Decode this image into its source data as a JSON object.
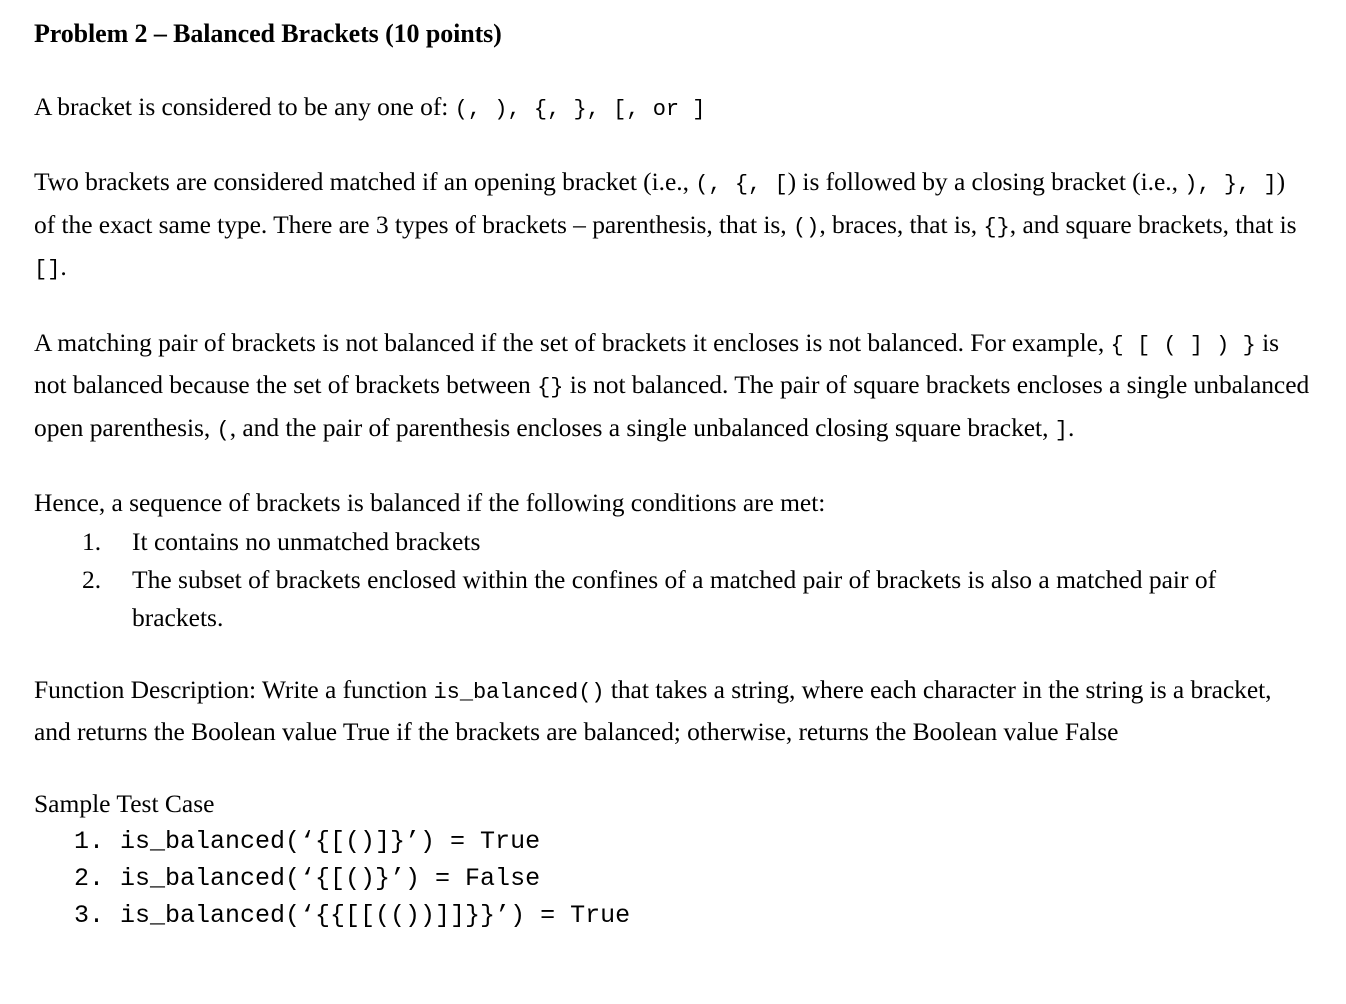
{
  "document": {
    "title": "Problem 2 – Balanced Brackets (10 points)",
    "paragraph_1": {
      "lead": "A bracket is considered to be any one of: ",
      "mono": "(,  ),  {,  },  [,  or  ]"
    },
    "paragraph_2": {
      "seg_1": "Two brackets are considered matched if an opening bracket (i.e., ",
      "mono_1": "(,  {,  [",
      "seg_2": ") is followed by a closing bracket (i.e., ",
      "mono_2": "),  },  ]",
      "seg_3": ") of the exact same type. There are 3 types of brackets – parenthesis, that is, ",
      "mono_3": "()",
      "seg_4": ", braces, that is, ",
      "mono_4": "{}",
      "seg_5": ", and square brackets, that is ",
      "mono_5": "[]",
      "seg_6": "."
    },
    "paragraph_3": {
      "seg_1": "A matching pair of brackets is not balanced if the set of brackets it encloses is not balanced. For example, ",
      "mono_1": "{  [  (  ]  )  }",
      "seg_2": " is not balanced because the set of brackets between ",
      "mono_2": "{}",
      "seg_3": " is not balanced.  The pair of square brackets encloses a single unbalanced open parenthesis, ",
      "mono_3": "(",
      "seg_4": ", and the pair of parenthesis encloses a single unbalanced closing square bracket, ",
      "mono_4": "]",
      "seg_5": "."
    },
    "conditions_intro": "Hence, a sequence of brackets is balanced if the following conditions are met:",
    "conditions": [
      "It contains no unmatched brackets",
      "The subset of brackets enclosed within the confines of a matched pair of brackets is also a matched pair of brackets."
    ],
    "function_description": {
      "seg_1": "Function Description: Write a function ",
      "mono_1": "is_balanced()",
      "seg_2": " that takes a string, where each character in the string is a bracket, and returns the Boolean value True if the brackets are balanced; otherwise, returns the Boolean value False"
    },
    "sample_heading": "Sample Test Case",
    "test_cases": [
      "is_balanced(‘{[()]}’) = True",
      "is_balanced(‘{[()}’) = False",
      "is_balanced(‘{{[[(())]]}}’) = True"
    ]
  }
}
